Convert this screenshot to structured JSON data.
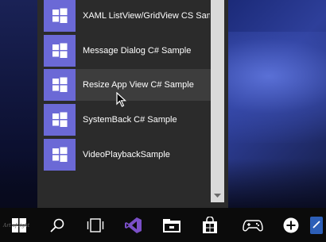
{
  "start_menu": {
    "items": [
      {
        "label": "XAML ListView/GridView CS Sample",
        "icon": "windows-logo-icon"
      },
      {
        "label": "Message Dialog C# Sample",
        "icon": "windows-logo-icon"
      },
      {
        "label": "Resize App View C# Sample",
        "icon": "windows-logo-icon"
      },
      {
        "label": "SystemBack C# Sample",
        "icon": "windows-logo-icon"
      },
      {
        "label": "VideoPlaybackSample",
        "icon": "windows-logo-icon"
      }
    ],
    "tile_color": "#6b69d6",
    "hover_item_index": 2
  },
  "taskbar": {
    "items": [
      {
        "icon": "start-icon"
      },
      {
        "icon": "search-icon"
      },
      {
        "icon": "task-view-icon"
      },
      {
        "icon": "visual-studio-icon"
      },
      {
        "icon": "file-explorer-icon"
      },
      {
        "icon": "store-icon"
      },
      {
        "icon": "xbox-controller-icon"
      },
      {
        "icon": "add-circle-icon"
      },
      {
        "icon": "app-icon"
      }
    ]
  },
  "colors": {
    "panel_bg": "#2b2b2b",
    "hover_bg": "#3d3d3d",
    "taskbar_bg": "#0b0b0b",
    "scrollbar": "#d9d9d9"
  }
}
